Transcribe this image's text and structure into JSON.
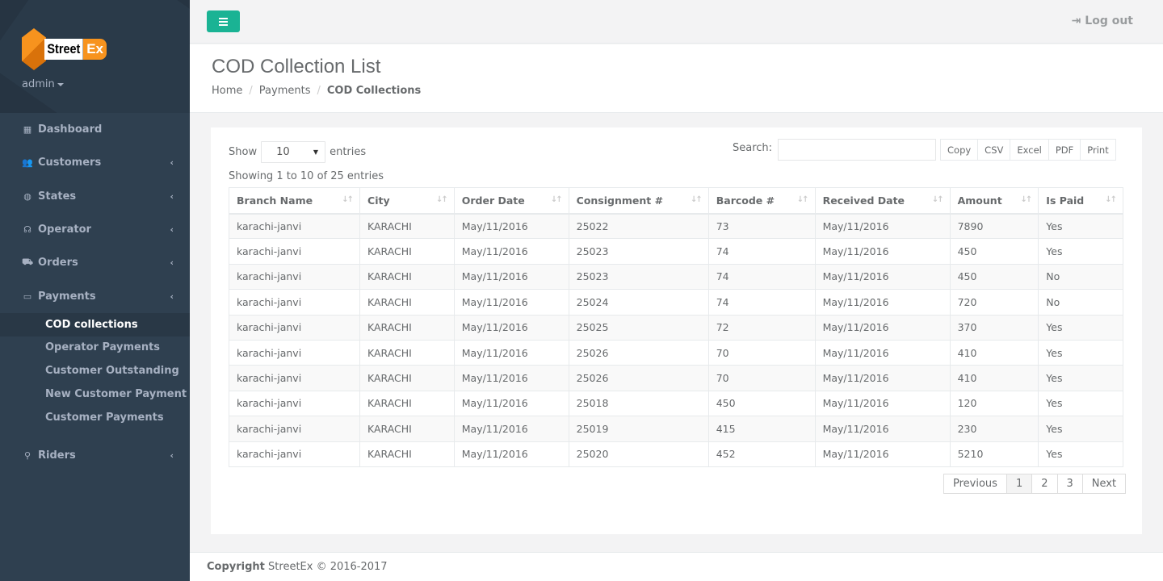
{
  "brand": {
    "word1": "Street",
    "word2": "Ex",
    "user": "admin"
  },
  "sidebar": {
    "items": [
      {
        "label": "Dashboard",
        "icon": "th-large-icon",
        "glyph": "▦",
        "arrow": ""
      },
      {
        "label": "Customers",
        "icon": "users-icon",
        "glyph": "👥",
        "arrow": "‹"
      },
      {
        "label": "States",
        "icon": "globe-icon",
        "glyph": "◍",
        "arrow": "‹"
      },
      {
        "label": "Operator",
        "icon": "headphones-icon",
        "glyph": "☊",
        "arrow": "‹"
      },
      {
        "label": "Orders",
        "icon": "truck-icon",
        "glyph": "⛟",
        "arrow": "‹"
      },
      {
        "label": "Payments",
        "icon": "credit-card-icon",
        "glyph": "▭",
        "arrow": "‹"
      }
    ],
    "sub_items": [
      "COD collections",
      "Operator Payments",
      "Customer Outstanding",
      "New Customer Payment",
      "Customer Payments"
    ],
    "riders": {
      "label": "Riders",
      "glyph": "⚲",
      "arrow": "‹"
    }
  },
  "topbar": {
    "logout": "Log out"
  },
  "page": {
    "title": "COD Collection List",
    "breadcrumb": [
      "Home",
      "Payments",
      "COD Collections"
    ]
  },
  "table_controls": {
    "show": "Show",
    "entries_value": "10",
    "entries": "entries",
    "search_label": "Search:",
    "search_value": "",
    "buttons": [
      "Copy",
      "CSV",
      "Excel",
      "PDF",
      "Print"
    ],
    "info": "Showing 1 to 10 of 25 entries"
  },
  "table": {
    "columns": [
      "Branch Name",
      "City",
      "Order Date",
      "Consignment #",
      "Barcode #",
      "Received Date",
      "Amount",
      "Is Paid"
    ],
    "rows": [
      [
        "karachi-janvi",
        "KARACHI",
        "May/11/2016",
        "25022",
        "73",
        "May/11/2016",
        "7890",
        "Yes"
      ],
      [
        "karachi-janvi",
        "KARACHI",
        "May/11/2016",
        "25023",
        "74",
        "May/11/2016",
        "450",
        "Yes"
      ],
      [
        "karachi-janvi",
        "KARACHI",
        "May/11/2016",
        "25023",
        "74",
        "May/11/2016",
        "450",
        "No"
      ],
      [
        "karachi-janvi",
        "KARACHI",
        "May/11/2016",
        "25024",
        "74",
        "May/11/2016",
        "720",
        "No"
      ],
      [
        "karachi-janvi",
        "KARACHI",
        "May/11/2016",
        "25025",
        "72",
        "May/11/2016",
        "370",
        "Yes"
      ],
      [
        "karachi-janvi",
        "KARACHI",
        "May/11/2016",
        "25026",
        "70",
        "May/11/2016",
        "410",
        "Yes"
      ],
      [
        "karachi-janvi",
        "KARACHI",
        "May/11/2016",
        "25026",
        "70",
        "May/11/2016",
        "410",
        "Yes"
      ],
      [
        "karachi-janvi",
        "KARACHI",
        "May/11/2016",
        "25018",
        "450",
        "May/11/2016",
        "120",
        "Yes"
      ],
      [
        "karachi-janvi",
        "KARACHI",
        "May/11/2016",
        "25019",
        "415",
        "May/11/2016",
        "230",
        "Yes"
      ],
      [
        "karachi-janvi",
        "KARACHI",
        "May/11/2016",
        "25020",
        "452",
        "May/11/2016",
        "5210",
        "Yes"
      ]
    ]
  },
  "pagination": [
    "Previous",
    "1",
    "2",
    "3",
    "Next"
  ],
  "footer": {
    "strong": "Copyright",
    "text": "StreetEx © 2016-2017"
  },
  "colors": {
    "sidebar": "#2f4050",
    "accent": "#1ab394",
    "logo_orange": "#f7931e"
  }
}
